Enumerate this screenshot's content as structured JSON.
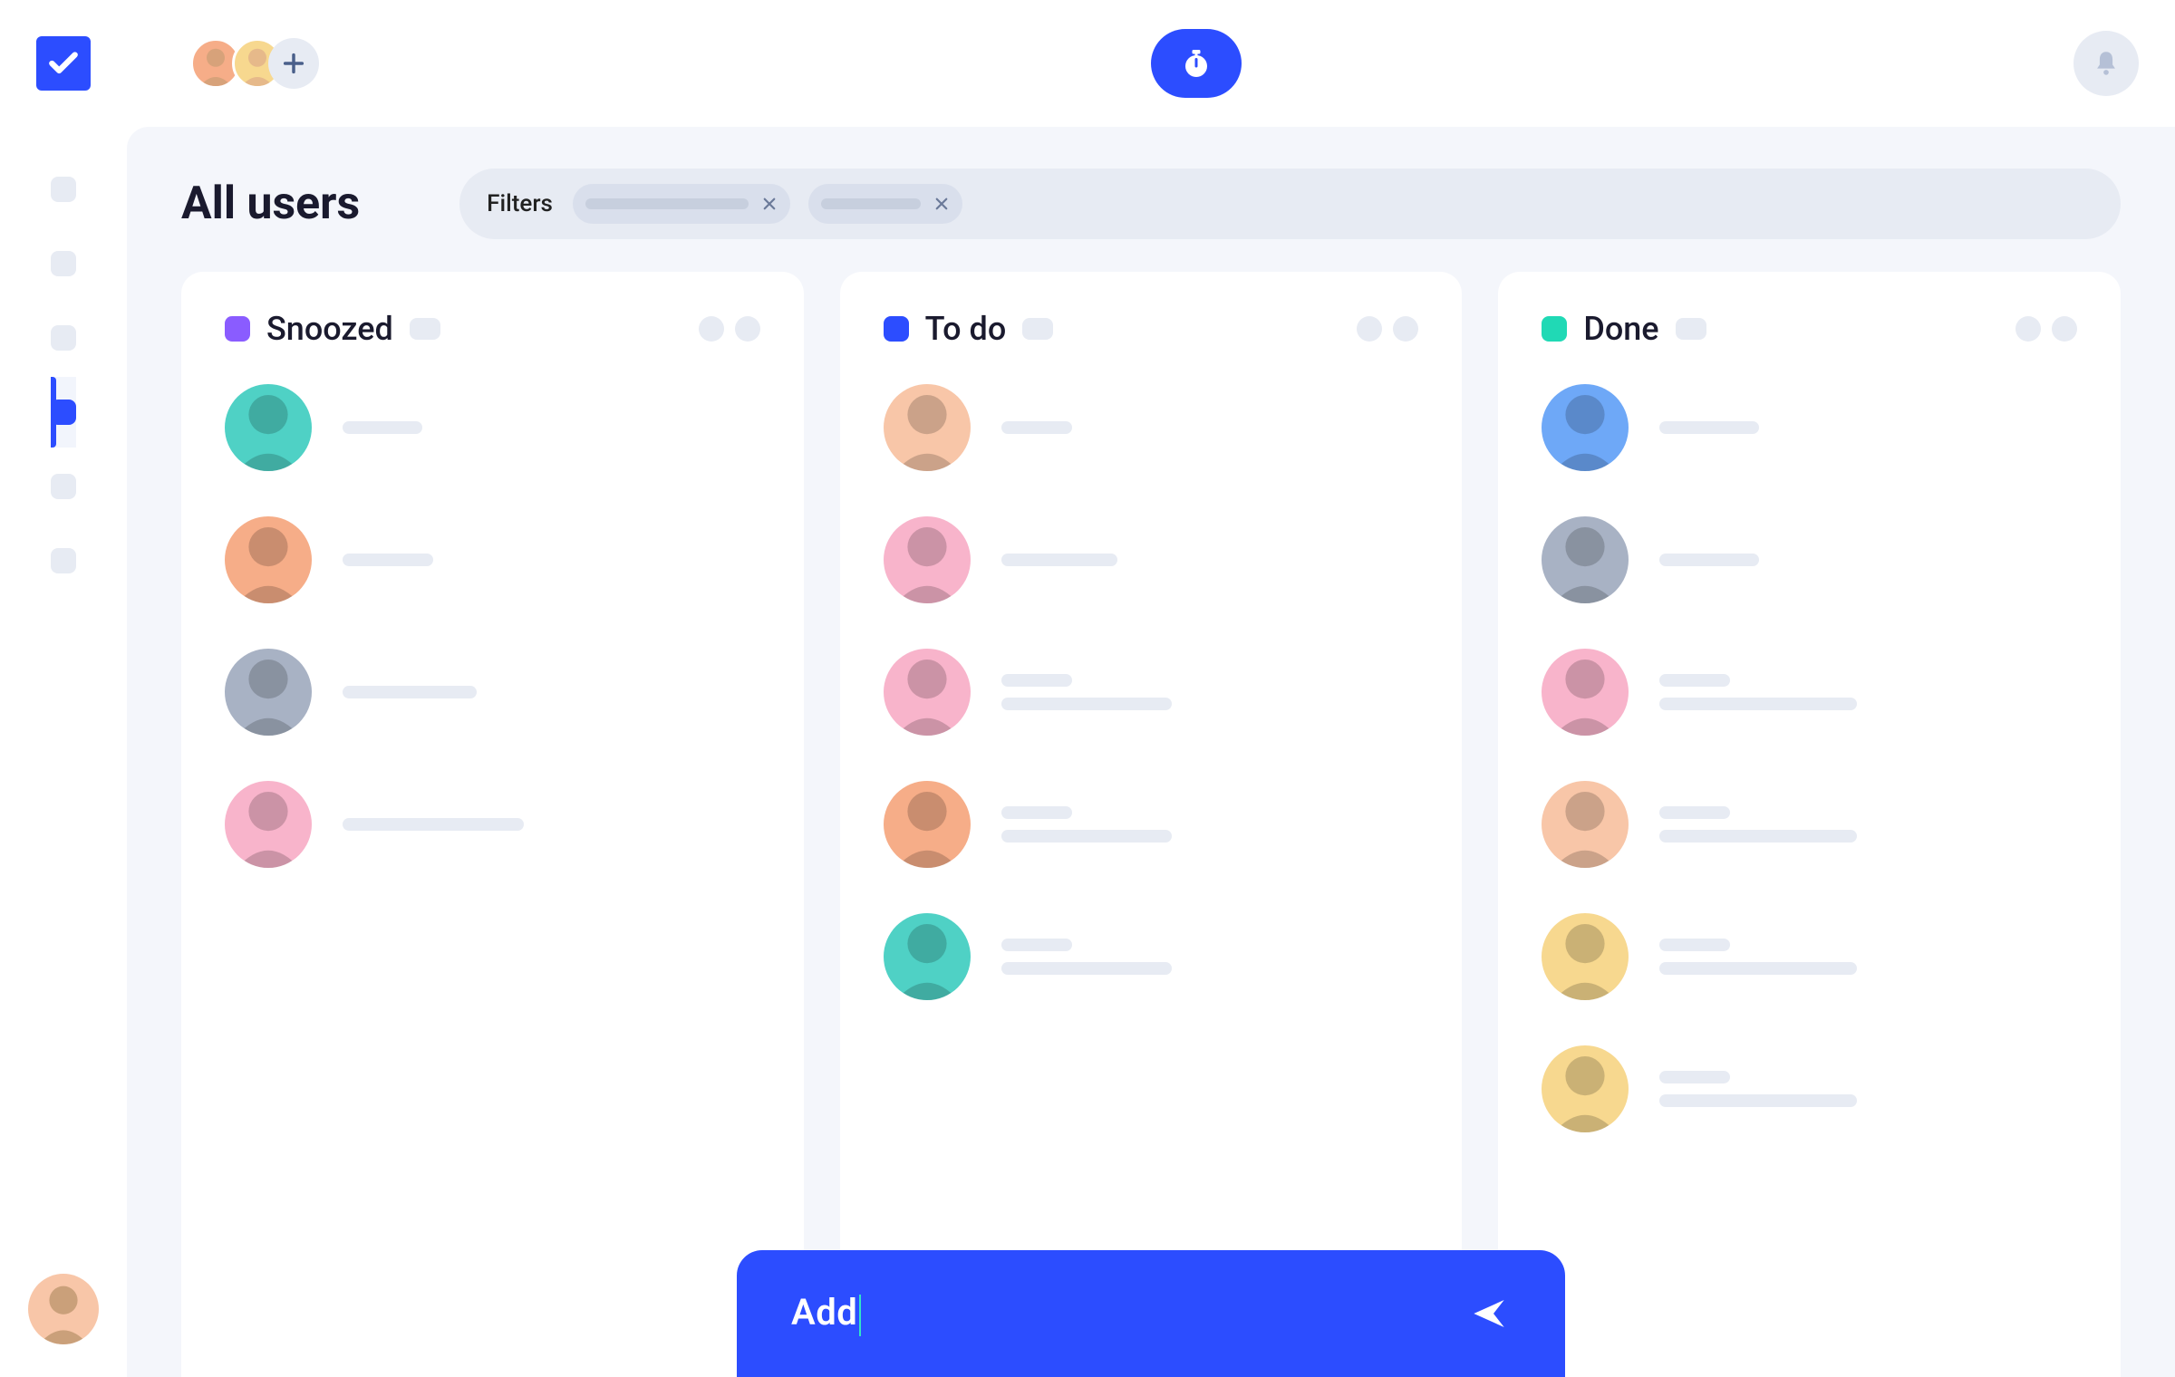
{
  "page": {
    "title": "All users"
  },
  "filters": {
    "label": "Filters",
    "chips": [
      {
        "width": 180
      },
      {
        "width": 110
      }
    ]
  },
  "columns": [
    {
      "id": "snoozed",
      "title": "Snoozed",
      "color": "#8a5cff",
      "cards": [
        {
          "avatar_bg": "bg-teal",
          "line1": 88,
          "line2": 0
        },
        {
          "avatar_bg": "bg-orange",
          "line1": 100,
          "line2": 0
        },
        {
          "avatar_bg": "bg-gray",
          "line1": 148,
          "line2": 0
        },
        {
          "avatar_bg": "bg-pink",
          "line1": 200,
          "line2": 0
        }
      ]
    },
    {
      "id": "todo",
      "title": "To do",
      "color": "#2c4dff",
      "cards": [
        {
          "avatar_bg": "bg-peach",
          "line1": 78,
          "line2": 0
        },
        {
          "avatar_bg": "bg-pink",
          "line1": 128,
          "line2": 0
        },
        {
          "avatar_bg": "bg-pink",
          "line1": 78,
          "line2": 188
        },
        {
          "avatar_bg": "bg-orange",
          "line1": 78,
          "line2": 188
        },
        {
          "avatar_bg": "bg-teal",
          "line1": 78,
          "line2": 188
        }
      ]
    },
    {
      "id": "done",
      "title": "Done",
      "color": "#20d9b5",
      "cards": [
        {
          "avatar_bg": "bg-blue",
          "line1": 110,
          "line2": 0
        },
        {
          "avatar_bg": "bg-gray",
          "line1": 110,
          "line2": 0
        },
        {
          "avatar_bg": "bg-pink",
          "line1": 78,
          "line2": 218
        },
        {
          "avatar_bg": "bg-peach",
          "line1": 78,
          "line2": 218
        },
        {
          "avatar_bg": "bg-yellow",
          "line1": 78,
          "line2": 218
        },
        {
          "avatar_bg": "bg-yellow",
          "line1": 78,
          "line2": 218
        }
      ]
    }
  ],
  "compose": {
    "text": "Add"
  },
  "sidebar": {
    "items": [
      {
        "active": false
      },
      {
        "active": false
      },
      {
        "active": false
      },
      {
        "active": true
      },
      {
        "active": false
      },
      {
        "active": false
      }
    ]
  }
}
